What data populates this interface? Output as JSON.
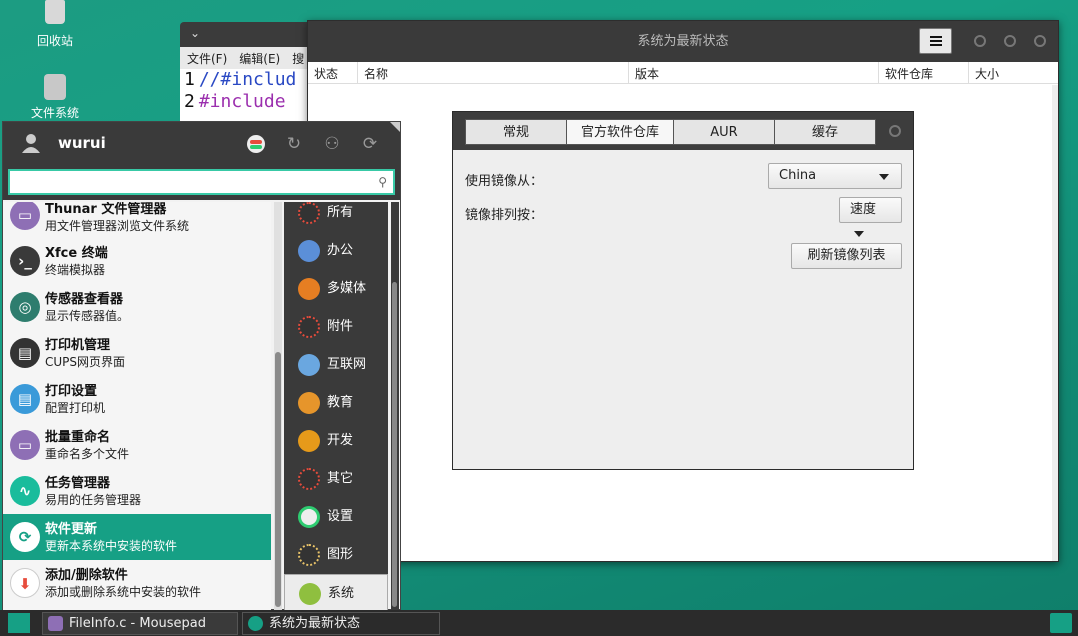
{
  "desktop": {
    "icons": [
      {
        "label": "回收站",
        "icon": "trash-icon"
      },
      {
        "label": "文件系统",
        "icon": "filesystem-icon"
      }
    ]
  },
  "mousepad": {
    "menus": [
      "文件(F)",
      "编辑(E)",
      "搜"
    ],
    "lines": [
      {
        "num": "1",
        "text": "//#includ"
      },
      {
        "num": "2",
        "text": "#include"
      }
    ]
  },
  "pamac": {
    "title": "系统为最新状态",
    "columns": [
      "状态",
      "名称",
      "版本",
      "软件仓库",
      "大小"
    ]
  },
  "prefs": {
    "tabs": [
      "常规",
      "官方软件仓库",
      "AUR",
      "缓存"
    ],
    "active_tab": "官方软件仓库",
    "mirror_from_label": "使用镜像从：",
    "mirror_from_value": "China",
    "sort_label": "镜像排列按：",
    "sort_value": "速度",
    "refresh_button": "刷新镜像列表"
  },
  "menu": {
    "username": "wurui",
    "search_placeholder": "",
    "apps": [
      {
        "title": "Thunar 文件管理器",
        "desc": "用文件管理器浏览文件系统",
        "icon": "folder-icon",
        "color": "#8e6fb5"
      },
      {
        "title": "Xfce 终端",
        "desc": "终端模拟器",
        "icon": "terminal-icon",
        "color": "#3a3a3a"
      },
      {
        "title": "传感器查看器",
        "desc": "显示传感器值。",
        "icon": "sensor-icon",
        "color": "#2e7d6e"
      },
      {
        "title": "打印机管理",
        "desc": "CUPS网页界面",
        "icon": "printer-icon",
        "color": "#333333"
      },
      {
        "title": "打印设置",
        "desc": "配置打印机",
        "icon": "printer-settings-icon",
        "color": "#3a9ad9"
      },
      {
        "title": "批量重命名",
        "desc": "重命名多个文件",
        "icon": "rename-icon",
        "color": "#8e6fb5"
      },
      {
        "title": "任务管理器",
        "desc": "易用的任务管理器",
        "icon": "task-manager-icon",
        "color": "#1abc9c"
      },
      {
        "title": "软件更新",
        "desc": "更新本系统中安装的软件",
        "icon": "update-icon",
        "color": "#16a085"
      },
      {
        "title": "添加/删除软件",
        "desc": "添加或删除系统中安装的软件",
        "icon": "package-icon",
        "color": "#e74c3c"
      }
    ],
    "selected_app": "软件更新",
    "categories": [
      {
        "label": "所有",
        "icon": "all-icon",
        "color": "#333333"
      },
      {
        "label": "办公",
        "icon": "office-icon",
        "color": "#5b8fd8"
      },
      {
        "label": "多媒体",
        "icon": "multimedia-icon",
        "color": "#e67e22"
      },
      {
        "label": "附件",
        "icon": "accessories-icon",
        "color": "#333333"
      },
      {
        "label": "互联网",
        "icon": "internet-icon",
        "color": "#6aa7e0"
      },
      {
        "label": "教育",
        "icon": "education-icon",
        "color": "#e6952b"
      },
      {
        "label": "开发",
        "icon": "development-icon",
        "color": "#e69a1a"
      },
      {
        "label": "其它",
        "icon": "other-icon",
        "color": "#333333"
      },
      {
        "label": "设置",
        "icon": "settings-icon",
        "color": "#eeeeee"
      },
      {
        "label": "图形",
        "icon": "graphics-icon",
        "color": "#333333"
      },
      {
        "label": "系统",
        "icon": "system-icon",
        "color": "#8fbf3f"
      }
    ],
    "selected_category": "系统"
  },
  "taskbar": {
    "items": [
      "FileInfo.c - Mousepad",
      "系统为最新状态"
    ]
  },
  "colors": {
    "accent": "#16a085",
    "titlebar": "#3a3a3a"
  }
}
